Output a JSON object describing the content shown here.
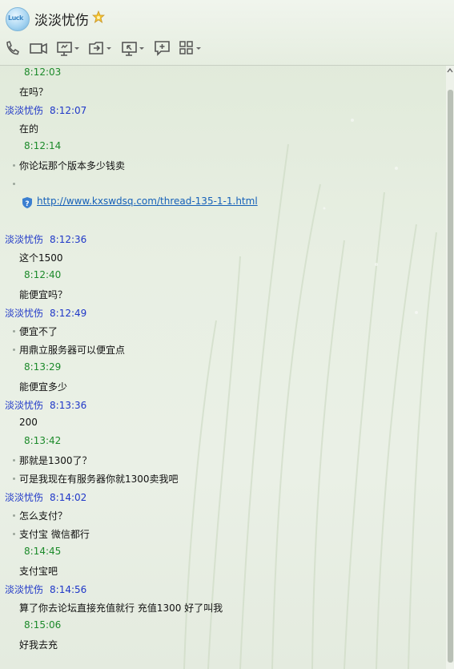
{
  "window": {
    "title": "淡淡忧伤",
    "avatar_text": "Luck"
  },
  "toolbar": {
    "icons": [
      "phone-icon",
      "video-icon",
      "screen-share-icon",
      "file-transfer-icon",
      "remote-desktop-icon",
      "add-chat-icon",
      "apps-icon"
    ]
  },
  "chat": {
    "entries": [
      {
        "type": "time",
        "text": "8:12:03"
      },
      {
        "type": "msg",
        "text": "在吗？"
      },
      {
        "type": "sender",
        "name": "淡淡忧伤",
        "time": "8:12:07"
      },
      {
        "type": "msg",
        "text": "在的"
      },
      {
        "type": "time",
        "text": "8:12:14"
      },
      {
        "type": "msg",
        "text": "你论坛那个版本多少钱卖",
        "bullet": true
      },
      {
        "type": "bullet-only"
      },
      {
        "type": "link",
        "text": "http://www.kxswdsq.com/thread-135-1-1.html"
      },
      {
        "type": "sender",
        "name": "淡淡忧伤",
        "time": "8:12:36"
      },
      {
        "type": "msg",
        "text": "这个1500"
      },
      {
        "type": "time",
        "text": "8:12:40"
      },
      {
        "type": "msg",
        "text": "能便宜吗？"
      },
      {
        "type": "sender",
        "name": "淡淡忧伤",
        "time": "8:12:49"
      },
      {
        "type": "msg",
        "text": "便宜不了",
        "bullet": true
      },
      {
        "type": "msg",
        "text": "用鼎立服务器可以便宜点",
        "bullet": true
      },
      {
        "type": "time",
        "text": "8:13:29"
      },
      {
        "type": "msg",
        "text": "能便宜多少"
      },
      {
        "type": "sender",
        "name": "淡淡忧伤",
        "time": "8:13:36"
      },
      {
        "type": "msg",
        "text": "200"
      },
      {
        "type": "time",
        "text": "8:13:42"
      },
      {
        "type": "msg",
        "text": "那就是1300了？",
        "bullet": true
      },
      {
        "type": "msg",
        "text": "可是我现在有服务器你就1300卖我吧",
        "bullet": true
      },
      {
        "type": "sender",
        "name": "淡淡忧伤",
        "time": "8:14:02"
      },
      {
        "type": "msg",
        "text": "怎么支付？",
        "bullet": true
      },
      {
        "type": "msg",
        "text": "支付宝 微信都行",
        "bullet": true
      },
      {
        "type": "time",
        "text": "8:14:45"
      },
      {
        "type": "msg",
        "text": "支付宝吧"
      },
      {
        "type": "sender",
        "name": "淡淡忧伤",
        "time": "8:14:56"
      },
      {
        "type": "msg",
        "text": "算了你去论坛直接充值就行 充值1300 好了叫我"
      },
      {
        "type": "time",
        "text": "8:15:06"
      },
      {
        "type": "msg",
        "text": "好我去充"
      }
    ]
  },
  "colors": {
    "sender": "#1f37c8",
    "time": "#1c8a2a",
    "link": "#1560b8"
  }
}
